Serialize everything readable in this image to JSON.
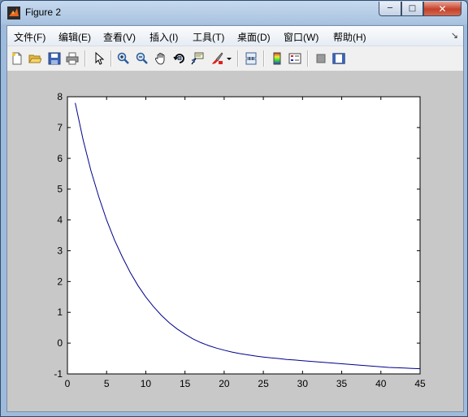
{
  "window": {
    "title": "Figure 2"
  },
  "menu": {
    "items": [
      {
        "label": "文件(F)"
      },
      {
        "label": "编辑(E)"
      },
      {
        "label": "查看(V)"
      },
      {
        "label": "插入(I)"
      },
      {
        "label": "工具(T)"
      },
      {
        "label": "桌面(D)"
      },
      {
        "label": "窗口(W)"
      },
      {
        "label": "帮助(H)"
      }
    ],
    "overflow_icon": "dock-arrow-icon"
  },
  "toolbar": {
    "icons": [
      "new-figure-icon",
      "open-file-icon",
      "save-icon",
      "print-icon",
      "edit-plot-arrow-icon",
      "zoom-in-icon",
      "zoom-out-icon",
      "pan-hand-icon",
      "rotate-3d-icon",
      "data-cursor-icon",
      "brush-icon",
      "brush-dropdown-icon",
      "link-plot-icon",
      "colorbar-icon",
      "legend-icon",
      "hide-plot-tools-icon",
      "show-plot-tools-icon"
    ]
  },
  "chart_data": {
    "type": "line",
    "title": "",
    "xlabel": "",
    "ylabel": "",
    "xlim": [
      0,
      45
    ],
    "ylim": [
      -1,
      8
    ],
    "xticks": [
      0,
      5,
      10,
      15,
      20,
      25,
      30,
      35,
      40,
      45
    ],
    "yticks": [
      -1,
      0,
      1,
      2,
      3,
      4,
      5,
      6,
      7,
      8
    ],
    "grid": false,
    "series": [
      {
        "color": "#00008b",
        "x": [
          1,
          2,
          3,
          4,
          5,
          6,
          7,
          8,
          9,
          10,
          11,
          12,
          13,
          14,
          15,
          16,
          17,
          18,
          19,
          20,
          21,
          22,
          23,
          24,
          25,
          26,
          27,
          28,
          29,
          30,
          31,
          32,
          33,
          34,
          35,
          36,
          37,
          38,
          39,
          40,
          41,
          42,
          43,
          44,
          45
        ],
        "y": [
          7.8,
          6.6,
          5.6,
          4.75,
          4.0,
          3.35,
          2.8,
          2.3,
          1.87,
          1.5,
          1.18,
          0.9,
          0.66,
          0.46,
          0.29,
          0.14,
          0.02,
          -0.08,
          -0.16,
          -0.23,
          -0.29,
          -0.34,
          -0.38,
          -0.42,
          -0.45,
          -0.48,
          -0.5,
          -0.53,
          -0.55,
          -0.57,
          -0.59,
          -0.61,
          -0.63,
          -0.65,
          -0.67,
          -0.69,
          -0.71,
          -0.73,
          -0.75,
          -0.77,
          -0.79,
          -0.8,
          -0.81,
          -0.82,
          -0.83
        ]
      }
    ]
  }
}
